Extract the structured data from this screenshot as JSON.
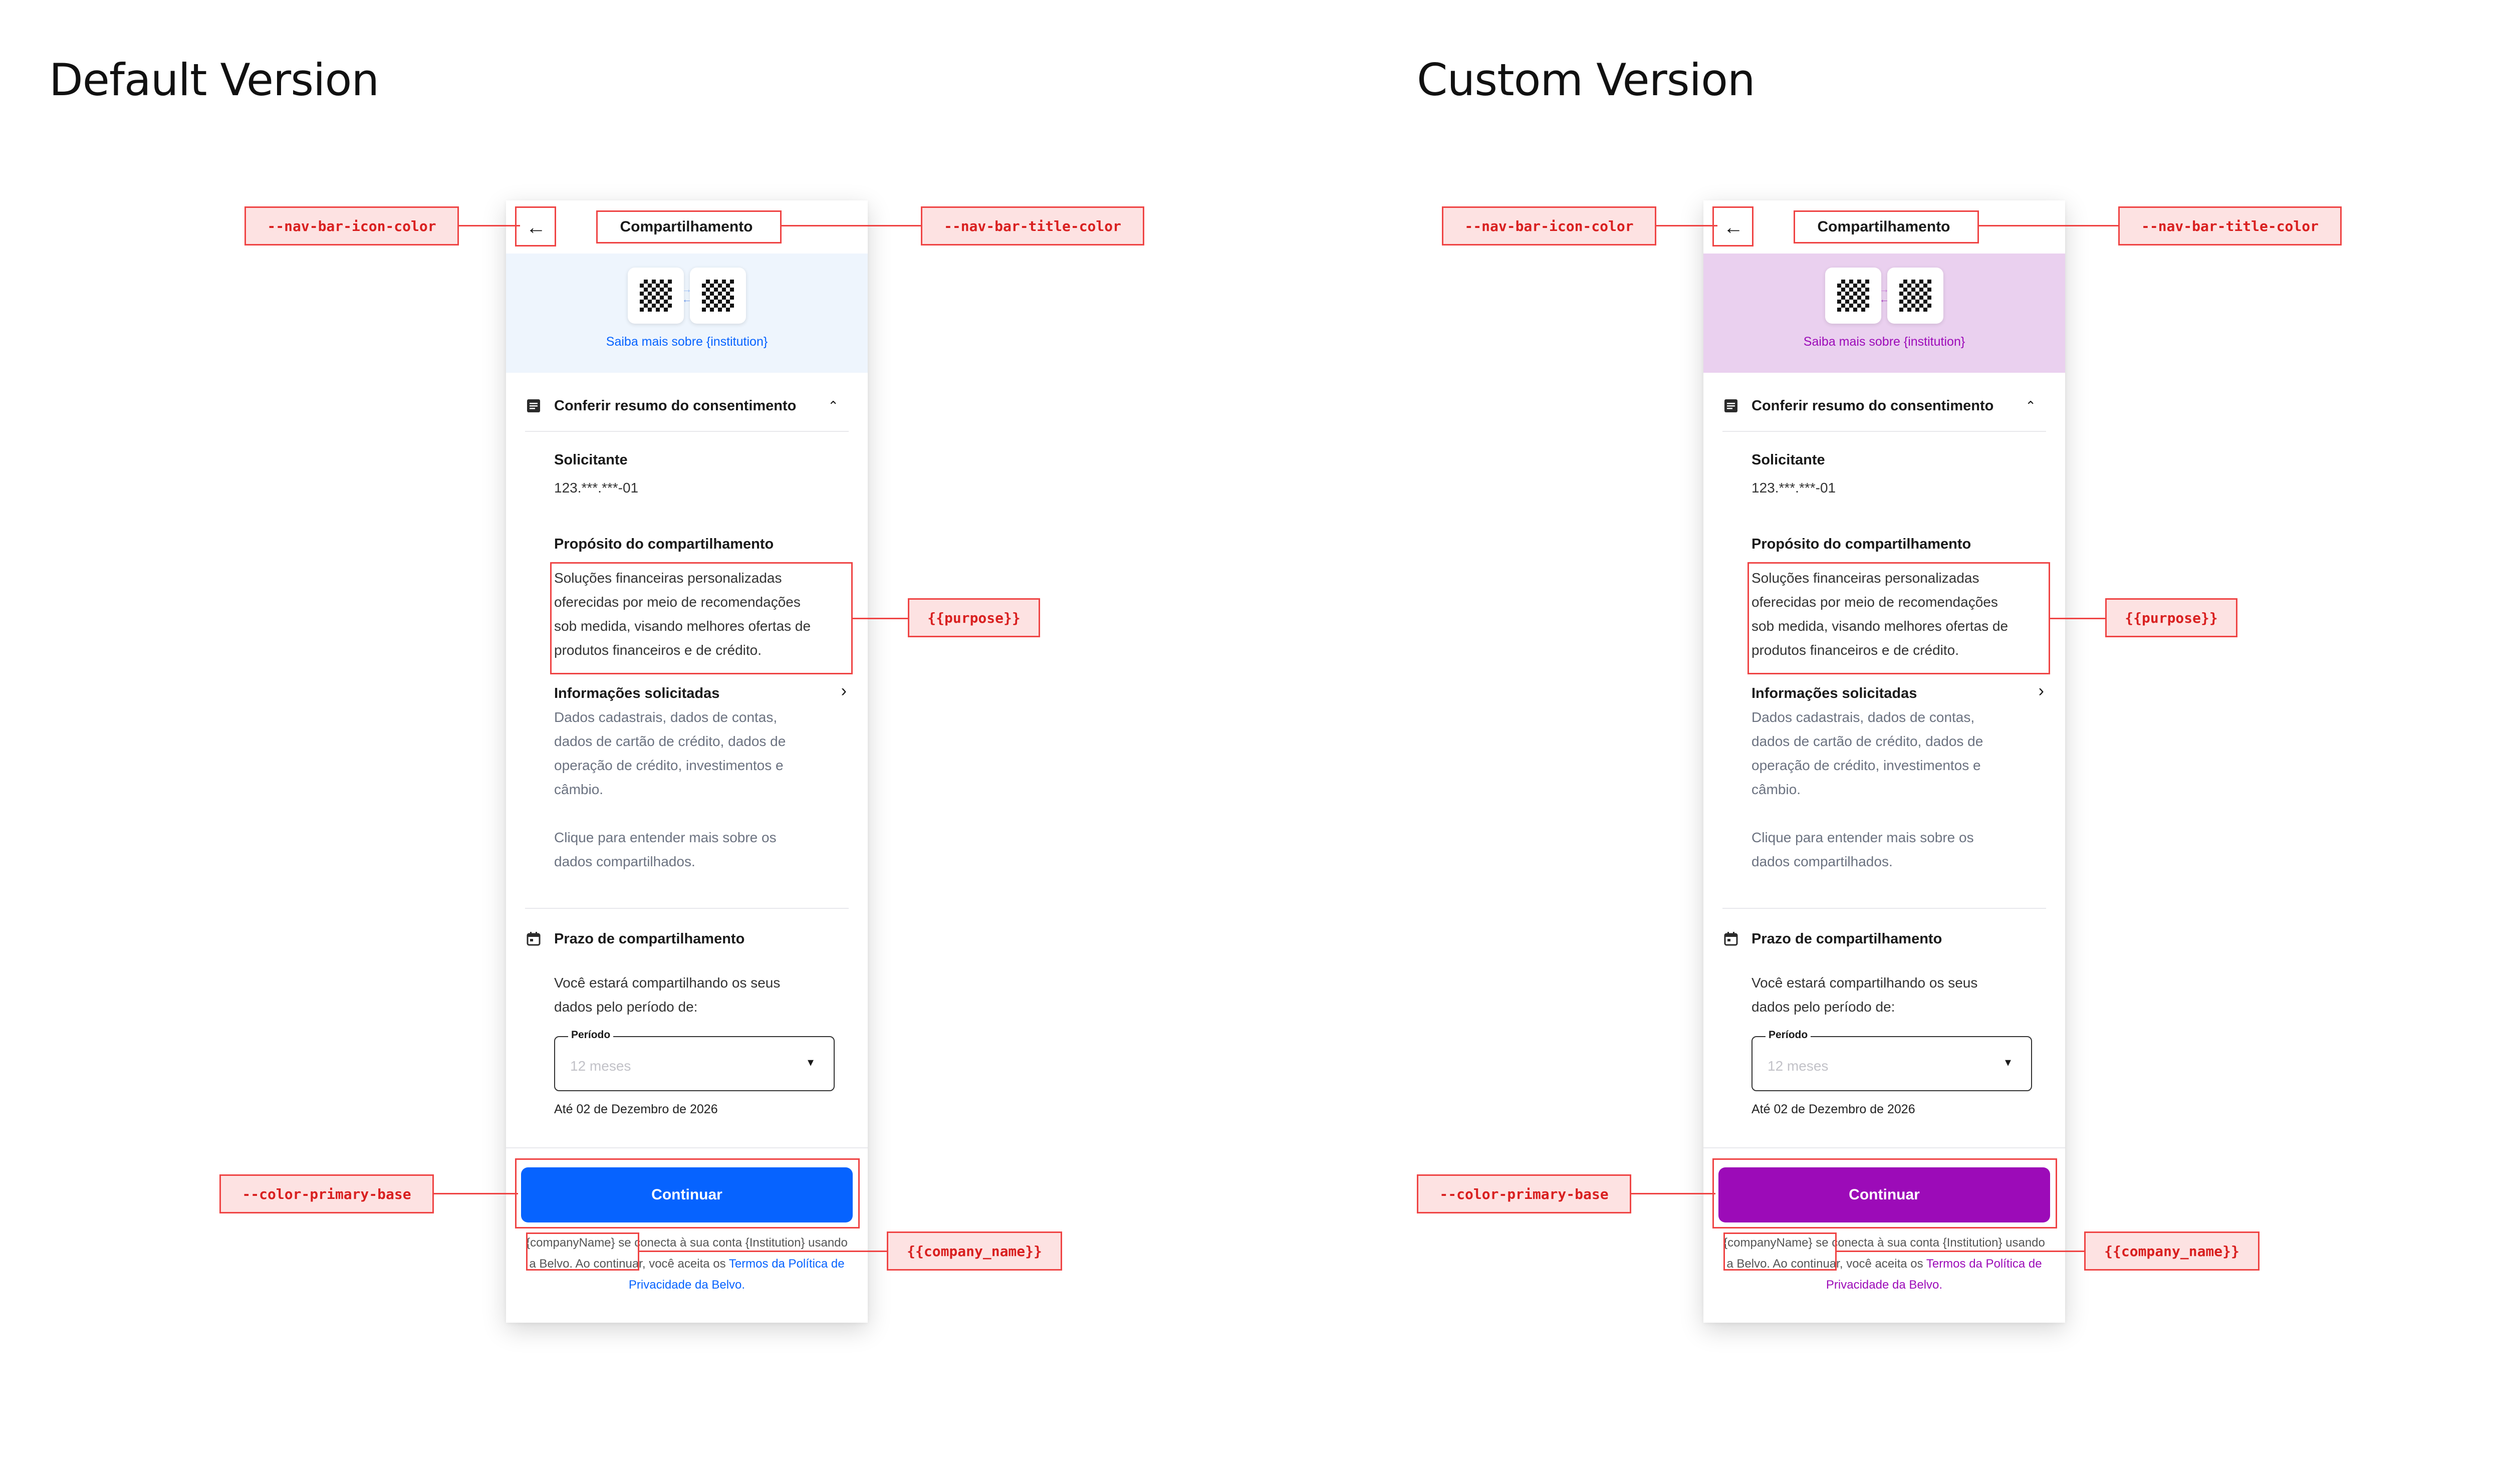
{
  "versions": [
    {
      "title": "Default Version",
      "colors": {
        "accent": "#0663ff",
        "banner_bg": "#eef5fd",
        "swap_top": "#9bbcf2",
        "swap_bottom": "#6a97e8"
      },
      "nav": {
        "back_icon": "arrow-left-icon",
        "title": "Compartilhamento"
      },
      "banner": {
        "link_text": "Saiba mais sobre {institution}"
      },
      "summary": {
        "heading": "Conferir resumo do consentimento",
        "requester_label": "Solicitante",
        "requester_value": "123.***.***-01",
        "purpose_label": "Propósito do compartilhamento",
        "purpose_lines": [
          "Soluções financeiras personalizadas",
          "oferecidas por meio de recomendações",
          "sob medida, visando melhores ofertas de",
          "produtos financeiros e de crédito."
        ],
        "info_label": "Informações solicitadas",
        "info_lines": [
          "Dados cadastrais, dados de contas,",
          "dados de cartão de crédito, dados de",
          "operação de crédito, investimentos e",
          "câmbio."
        ],
        "info_more_lines": [
          "Clique para entender mais sobre os",
          "dados compartilhados."
        ]
      },
      "period": {
        "heading": "Prazo de compartilhamento",
        "desc_lines": [
          "Você estará compartilhando os seus",
          "dados pelo período de:"
        ],
        "field_label": "Período",
        "field_value": "12 meses",
        "until": "Até 02 de Dezembro de 2026"
      },
      "cta": {
        "label": "Continuar"
      },
      "terms": {
        "company": "{companyName}",
        "middle": " se conecta à sua conta {Institution} usando a Belvo. Ao continuar, você aceita os ",
        "link": "Termos da Política de Privacidade da Belvo."
      },
      "annotations": {
        "nav_icon": "--nav-bar-icon-color",
        "nav_title": "--nav-bar-title-color",
        "purpose": "{{purpose}}",
        "primary": "--color-primary-base",
        "company": "{{company_name}}"
      }
    },
    {
      "title": "Custom Version",
      "colors": {
        "accent": "#9c0bb8",
        "banner_bg": "#ead0ef",
        "swap_top": "#c77fd6",
        "swap_bottom": "#a33cbc"
      },
      "nav": {
        "back_icon": "arrow-left-icon",
        "title": "Compartilhamento"
      },
      "banner": {
        "link_text": "Saiba mais sobre {institution}"
      },
      "summary": {
        "heading": "Conferir resumo do consentimento",
        "requester_label": "Solicitante",
        "requester_value": "123.***.***-01",
        "purpose_label": "Propósito do compartilhamento",
        "purpose_lines": [
          "Soluções financeiras personalizadas",
          "oferecidas por meio de recomendações",
          "sob medida, visando melhores ofertas de",
          "produtos financeiros e de crédito."
        ],
        "info_label": "Informações solicitadas",
        "info_lines": [
          "Dados cadastrais, dados de contas,",
          "dados de cartão de crédito, dados de",
          "operação de crédito, investimentos e",
          "câmbio."
        ],
        "info_more_lines": [
          "Clique para entender mais sobre os",
          "dados compartilhados."
        ]
      },
      "period": {
        "heading": "Prazo de compartilhamento",
        "desc_lines": [
          "Você estará compartilhando os seus",
          "dados pelo período de:"
        ],
        "field_label": "Período",
        "field_value": "12 meses",
        "until": "Até 02 de Dezembro de 2026"
      },
      "cta": {
        "label": "Continuar"
      },
      "terms": {
        "company": "{companyName}",
        "middle": " se conecta à sua conta {Institution} usando a Belvo. Ao continuar, você aceita os ",
        "link": "Termos da Política de Privacidade da Belvo."
      },
      "annotations": {
        "nav_icon": "--nav-bar-icon-color",
        "nav_title": "--nav-bar-title-color",
        "purpose": "{{purpose}}",
        "primary": "--color-primary-base",
        "company": "{{company_name}}"
      }
    }
  ]
}
